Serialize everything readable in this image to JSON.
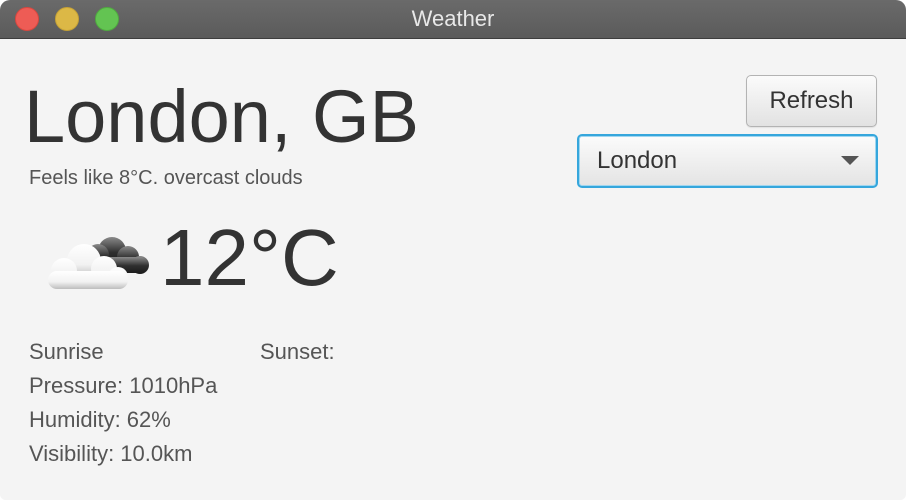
{
  "window": {
    "title": "Weather"
  },
  "location": {
    "name": "London, GB"
  },
  "summary": {
    "feels_like": "Feels like 8°C. overcast clouds"
  },
  "current": {
    "temperature": "12°C",
    "icon": "overcast-clouds-icon"
  },
  "details": {
    "sunrise": "Sunrise",
    "sunset": "Sunset:",
    "pressure": "Pressure: 1010hPa",
    "humidity": "Humidity: 62%",
    "visibility": "Visibility: 10.0km"
  },
  "controls": {
    "refresh_label": "Refresh",
    "city_selected": "London"
  },
  "colors": {
    "accent_focus": "#35a6dc",
    "text_primary": "#333333",
    "text_secondary": "#555555",
    "background": "#f4f4f4"
  }
}
